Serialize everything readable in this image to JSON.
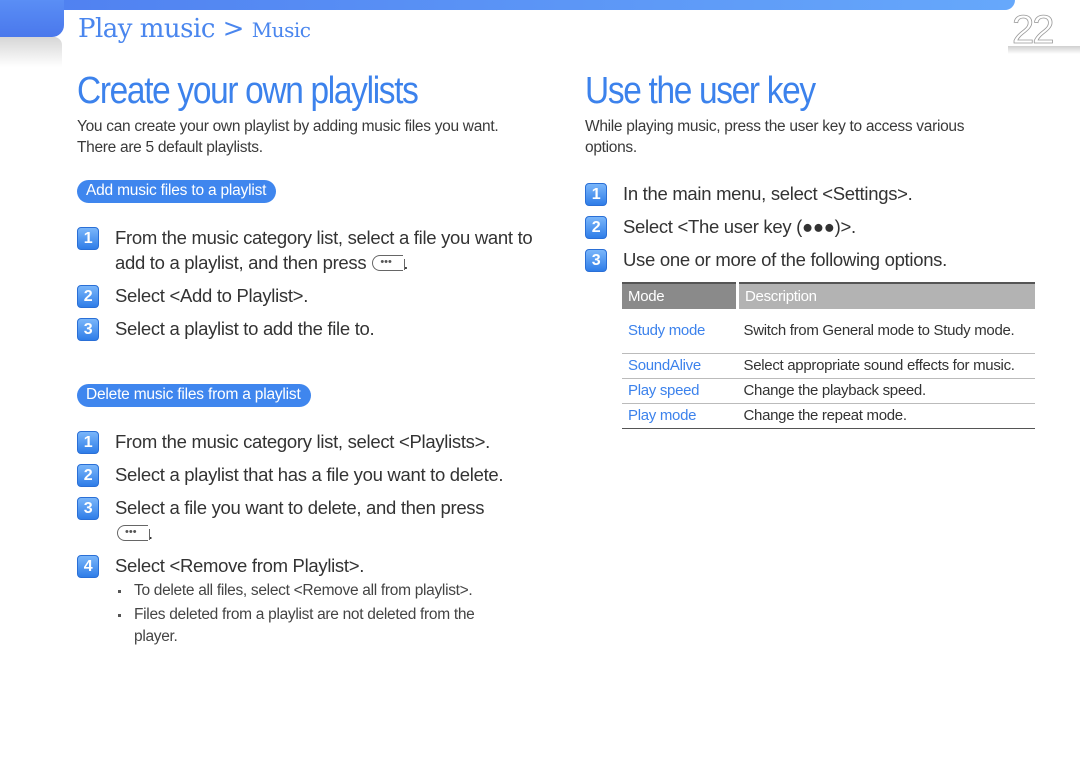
{
  "header": {
    "breadcrumb_main": "Play music >",
    "breadcrumb_sub": "Music",
    "page_number": "22"
  },
  "left": {
    "title": "Create your own playlists",
    "intro": "You can create your own playlist by adding music files you want. There are 5 default playlists.",
    "add_section": {
      "label": "Add music files to a playlist",
      "steps": [
        {
          "num": "1",
          "text": "From the music category list, select a file you want to add to a playlist, and then press",
          "icon": "user-key-icon",
          "suffix": "."
        },
        {
          "num": "2",
          "text": "Select <Add to Playlist>."
        },
        {
          "num": "3",
          "text": "Select a playlist to add the file to."
        }
      ]
    },
    "delete_section": {
      "label": "Delete music files from a playlist",
      "steps": [
        {
          "num": "1",
          "text": "From the music category list, select <Playlists>."
        },
        {
          "num": "2",
          "text": "Select a playlist that has a file you want to delete."
        },
        {
          "num": "3",
          "text": "Select a file you want to delete, and then press",
          "icon": "user-key-icon",
          "suffix": "."
        },
        {
          "num": "4",
          "text": "Select <Remove from Playlist>."
        }
      ],
      "notes": [
        "To delete all files, select <Remove all from playlist>.",
        "Files deleted from a playlist are not deleted from the player."
      ]
    }
  },
  "right": {
    "title": "Use the user key",
    "intro": "While playing music, press the user key to access various options.",
    "steps": [
      {
        "num": "1",
        "text": "In the main menu, select <Settings>."
      },
      {
        "num": "2",
        "text": "Select <The user key (●●●)>."
      },
      {
        "num": "3",
        "text": "Use one or more of the following options."
      }
    ],
    "table": {
      "headers": [
        "Mode",
        "Description"
      ],
      "rows": [
        {
          "mode": "Study mode",
          "description": "Switch from General mode to Study mode."
        },
        {
          "mode": "SoundAlive",
          "description": "Select appropriate sound effects for music."
        },
        {
          "mode": "Play speed",
          "description": "Change the playback speed."
        },
        {
          "mode": "Play mode",
          "description": "Change the repeat mode."
        }
      ]
    }
  },
  "icons": {
    "key_glyph": "•••"
  },
  "colors": {
    "accent": "#3c82ec",
    "header_gray": "#8a8a8a",
    "header_light_gray": "#b3b3b3"
  }
}
